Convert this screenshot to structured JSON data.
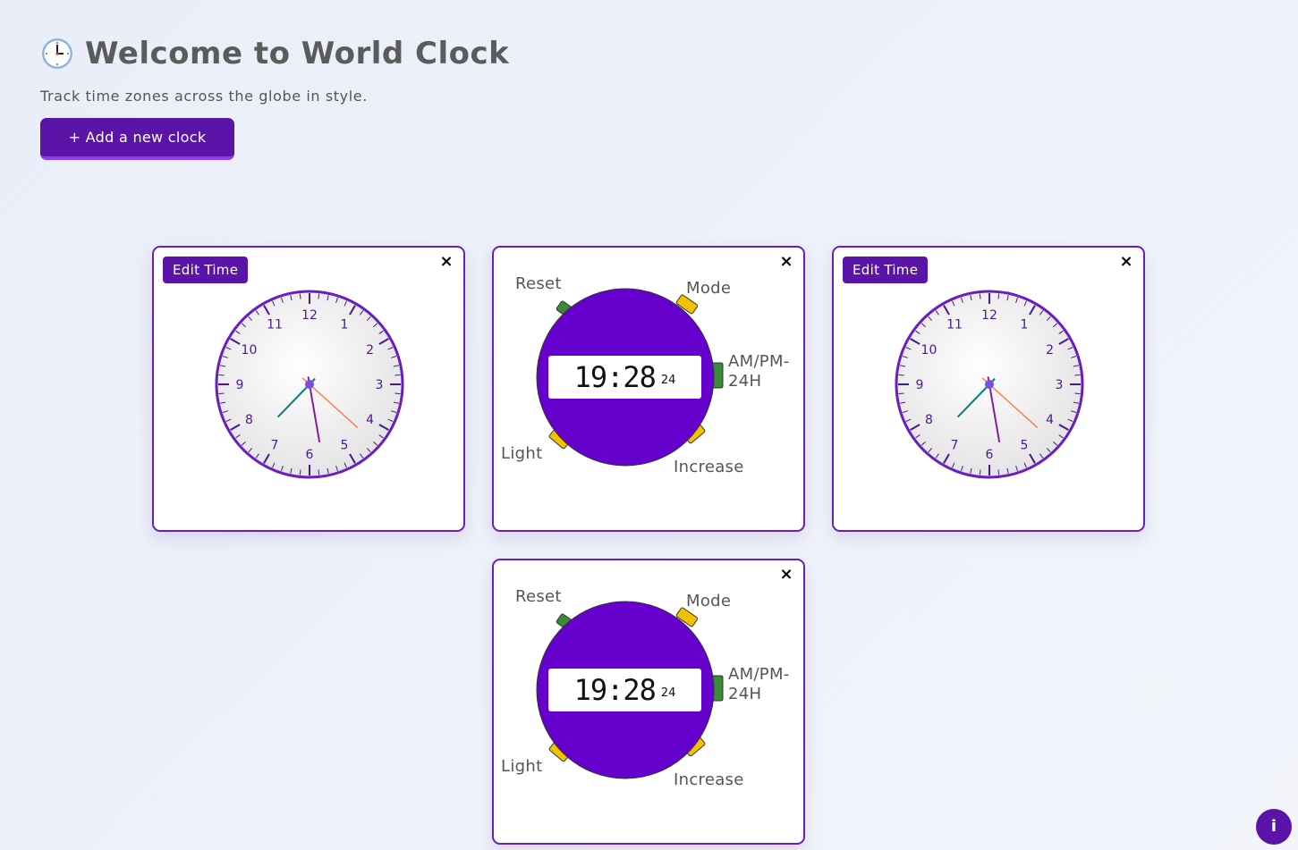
{
  "header": {
    "title_icon": "clock-icon",
    "title": "Welcome to World Clock",
    "subtitle": "Track time zones across the globe in style.",
    "add_clock_label": "+ Add a new clock"
  },
  "colors": {
    "accent": "#5a14a8",
    "watch_body": "#6600cc",
    "button_green": "#3a8a3a",
    "button_yellow": "#f2c200",
    "hour_hand": "#008080",
    "minute_hand": "#8b1a9a",
    "second_hand": "#ff7f50"
  },
  "analog_clocks": [
    {
      "edit_label": "Edit Time",
      "close_label": "×",
      "numerals": [
        "12",
        "1",
        "2",
        "3",
        "4",
        "5",
        "6",
        "7",
        "8",
        "9",
        "10",
        "11"
      ],
      "time": "19:28:22"
    },
    {
      "edit_label": "Edit Time",
      "close_label": "×",
      "numerals": [
        "12",
        "1",
        "2",
        "3",
        "4",
        "5",
        "6",
        "7",
        "8",
        "9",
        "10",
        "11"
      ],
      "time": "19:28:22"
    }
  ],
  "digital_clocks": [
    {
      "close_label": "×",
      "time": "19:28",
      "format": "24",
      "buttons": {
        "reset": "Reset",
        "mode": "Mode",
        "ampm": "AM/PM-",
        "ampm2": "24H",
        "light": "Light",
        "increase": "Increase"
      }
    },
    {
      "close_label": "×",
      "time": "19:28",
      "format": "24",
      "buttons": {
        "reset": "Reset",
        "mode": "Mode",
        "ampm": "AM/PM-",
        "ampm2": "24H",
        "light": "Light",
        "increase": "Increase"
      }
    }
  ],
  "info_button": "i"
}
